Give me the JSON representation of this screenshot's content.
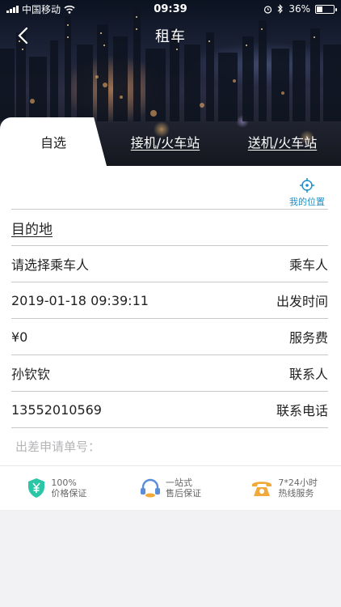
{
  "status_bar": {
    "carrier": "中国移动",
    "time": "09:39",
    "battery": "36%",
    "battery_level": 0.36
  },
  "nav": {
    "title": "租车",
    "back_icon": "chevron-left-icon"
  },
  "tabs": [
    {
      "label": "自选",
      "active": true
    },
    {
      "label": "接机/火车站",
      "active": false
    },
    {
      "label": "送机/火车站",
      "active": false
    }
  ],
  "location": {
    "label": "我的位置",
    "icon": "crosshair-icon",
    "color": "#1e8fc8"
  },
  "form": {
    "destination": "目的地",
    "passenger": {
      "value": "请选择乘车人",
      "label": "乘车人"
    },
    "departure": {
      "value": "2019-01-18 09:39:11",
      "label": "出发时间"
    },
    "service_fee": {
      "value": "¥0",
      "label": "服务费"
    },
    "contact": {
      "value": "孙钦钦",
      "label": "联系人"
    },
    "phone": {
      "value": "13552010569",
      "label": "联系电话"
    },
    "trip_request": {
      "placeholder": "出差申请单号："
    }
  },
  "guarantees": [
    {
      "line1": "100%",
      "line2": "价格保证",
      "icon": "shield-yen-icon",
      "color": "#2bc6a5"
    },
    {
      "line1": "一站式",
      "line2": "售后保证",
      "icon": "headset-icon",
      "color": "#5b8ed8"
    },
    {
      "line1": "7*24小时",
      "line2": "热线服务",
      "icon": "telephone-icon",
      "color": "#f2a93b"
    }
  ]
}
